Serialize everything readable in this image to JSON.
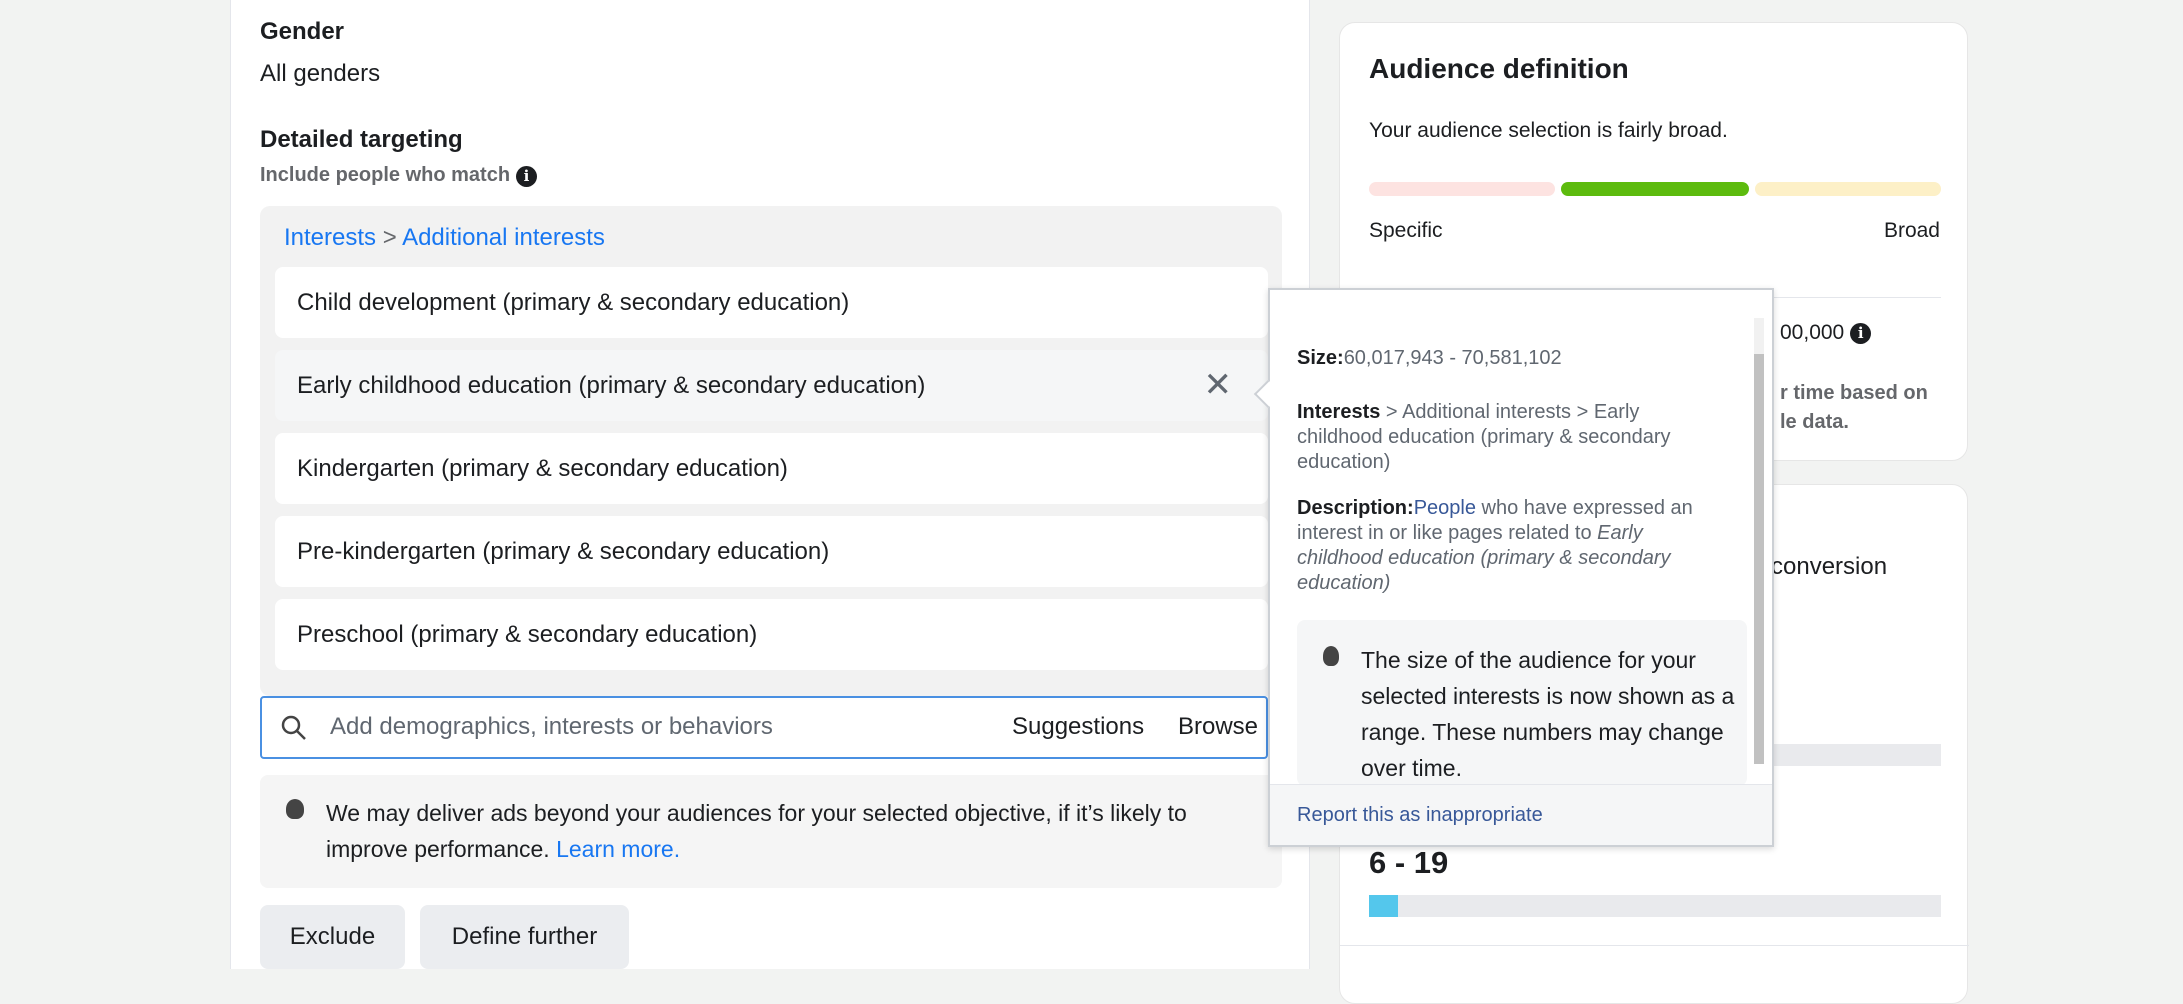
{
  "left": {
    "gender_label": "Gender",
    "gender_value": "All genders",
    "detailed_label": "Detailed targeting",
    "include_label": "Include people who match",
    "breadcrumb": {
      "a": "Interests",
      "sep": ">",
      "b": "Additional interests"
    },
    "items": [
      "Child development (primary & secondary education)",
      "Early childhood education (primary & secondary education)",
      "Kindergarten (primary & secondary education)",
      "Pre-kindergarten (primary & secondary education)",
      "Preschool (primary & secondary education)"
    ],
    "search_placeholder": "Add demographics, interests or behaviors",
    "suggestions": "Suggestions",
    "browse": "Browse",
    "note": "We may deliver ads beyond your audiences for your selected objective, if it’s likely to improve performance.",
    "learn_more": "Learn more.",
    "exclude": "Exclude",
    "define_further": "Define further"
  },
  "audience": {
    "title": "Audience definition",
    "status": "Your audience selection is fairly broad.",
    "meter_level": "fairly broad",
    "specific": "Specific",
    "broad": "Broad",
    "size_partial": "00,000",
    "note_partial_1": "r time based on",
    "note_partial_2": "le data.",
    "colors": {
      "specific": "#fde3e1",
      "mid": "#5dbb0e",
      "broad": "#fdf0c7"
    }
  },
  "card2": {
    "partial": "conversion",
    "range": "6 - 19",
    "range_fill_percent": 5,
    "bar_color": "#54c7ec"
  },
  "popup": {
    "size_label": "Size:",
    "size_value": "60,017,943 - 70,581,102",
    "path_bold": "Interests",
    "path_rest": " > Additional interests > Early childhood education (primary & secondary education)",
    "desc_label": "Description:",
    "desc_link": "People",
    "desc_text": " who have expressed an interest in or like pages related to ",
    "desc_italic": "Early childhood education (primary & secondary education)",
    "tip": "The size of the audience for your selected interests is now shown as a range. These numbers may change over time.",
    "report": "Report this as inappropriate"
  }
}
